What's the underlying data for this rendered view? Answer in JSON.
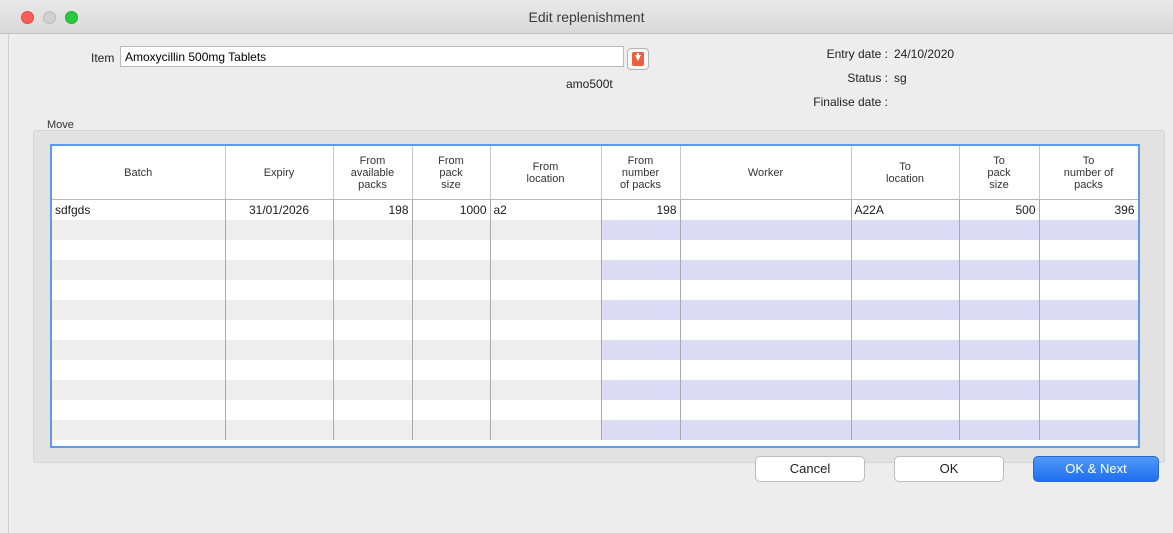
{
  "window": {
    "title": "Edit replenishment"
  },
  "form": {
    "item_label": "Item",
    "item_value": "Amoxycillin 500mg Tablets",
    "item_code": "amo500t",
    "entry_date_label": "Entry date :",
    "entry_date_value": "24/10/2020",
    "status_label": "Status :",
    "status_value": "sg",
    "finalise_date_label": "Finalise date :",
    "finalise_date_value": ""
  },
  "move": {
    "section_label": "Move",
    "columns": [
      "Batch",
      "Expiry",
      "From\navailable\npacks",
      "From\npack\nsize",
      "From\nlocation",
      "From\nnumber\nof packs",
      "Worker",
      "To\nlocation",
      "To\npack\nsize",
      "To\nnumber of\npacks"
    ],
    "rows": [
      {
        "batch": "sdfgds",
        "expiry": "31/01/2026",
        "from_available_packs": "198",
        "from_pack_size": "1000",
        "from_location": "a2",
        "from_number_of_packs": "198",
        "worker": "",
        "to_location": "A22A",
        "to_pack_size": "500",
        "to_number_of_packs": "396"
      }
    ]
  },
  "buttons": {
    "cancel": "Cancel",
    "ok": "OK",
    "ok_next": "OK & Next"
  },
  "colors": {
    "accent": "#1f6ff0",
    "table_focus_border": "#5b9bea",
    "editable_row_tint": "#dcdcf6"
  }
}
